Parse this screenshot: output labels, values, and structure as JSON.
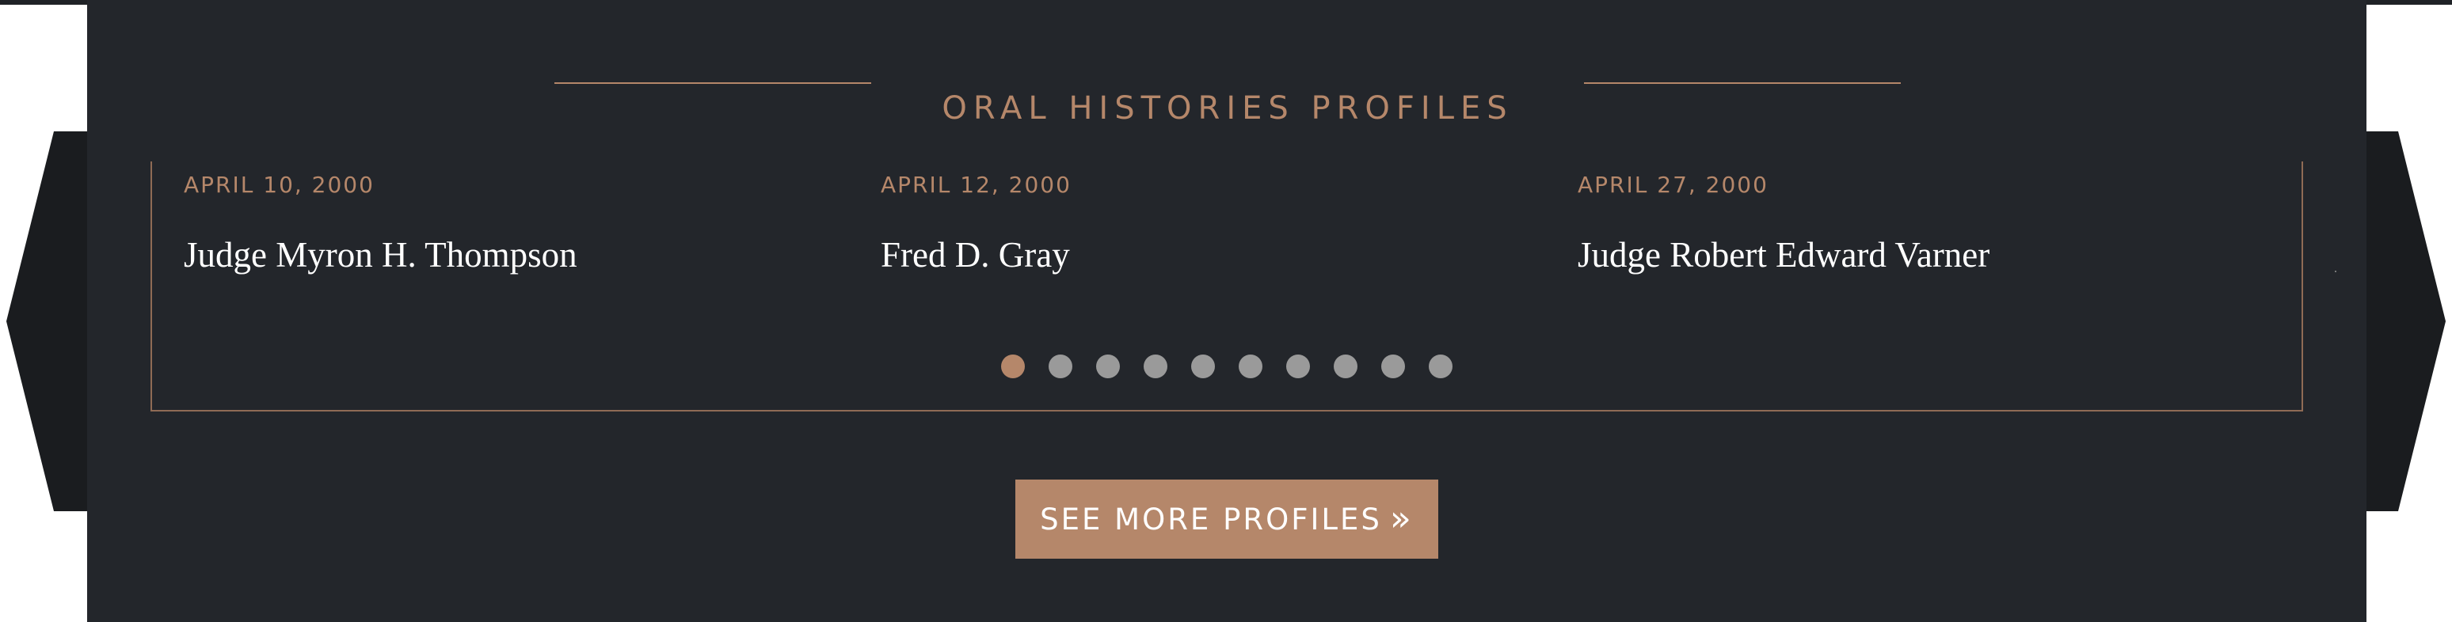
{
  "section": {
    "title": "ORAL HISTORIES PROFILES"
  },
  "carousel": {
    "slides": [
      {
        "date": "APRIL 10, 2000",
        "name": "Judge Myron H. Thompson"
      },
      {
        "date": "APRIL 12, 2000",
        "name": "Fred D. Gray"
      },
      {
        "date": "APRIL 27, 2000",
        "name": "Judge Robert Edward Varner"
      }
    ],
    "pagination": {
      "total": 10,
      "active": 1
    }
  },
  "cta": {
    "label": "SEE MORE PROFILES",
    "icon": "double-chevron-right-icon"
  },
  "colors": {
    "panel_background": "#23262b",
    "accent": "#b5876a",
    "wing": "#1a1c1f",
    "dot_inactive": "#9a9a9a",
    "name_text": "#ffffff"
  }
}
